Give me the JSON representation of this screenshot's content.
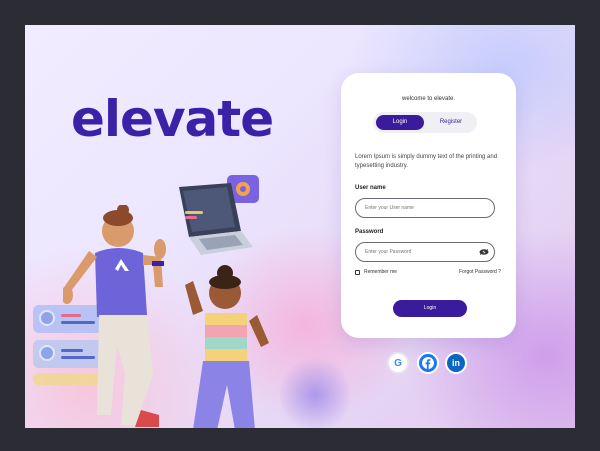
{
  "brand": {
    "name": "elevate"
  },
  "panel": {
    "welcome": "welcome to elevate.",
    "tabs": [
      {
        "label": "Login",
        "active": true
      },
      {
        "label": "Register",
        "active": false
      }
    ],
    "description": "Lorem Ipsum is simply dummy text of the printing and typesetting industry.",
    "username": {
      "label": "User name",
      "placeholder": "Enter your User name"
    },
    "password": {
      "label": "Password",
      "placeholder": "Enter your Password"
    },
    "remember_label": "Remember me",
    "forgot_label": "Forgot Password ?",
    "login_button": "Login"
  },
  "social": [
    {
      "name": "google",
      "glyph": "G"
    },
    {
      "name": "facebook",
      "glyph": "f"
    },
    {
      "name": "linkedin",
      "glyph": "in"
    }
  ],
  "colors": {
    "accent": "#3a1b9c",
    "brand": "#3b21a8"
  }
}
